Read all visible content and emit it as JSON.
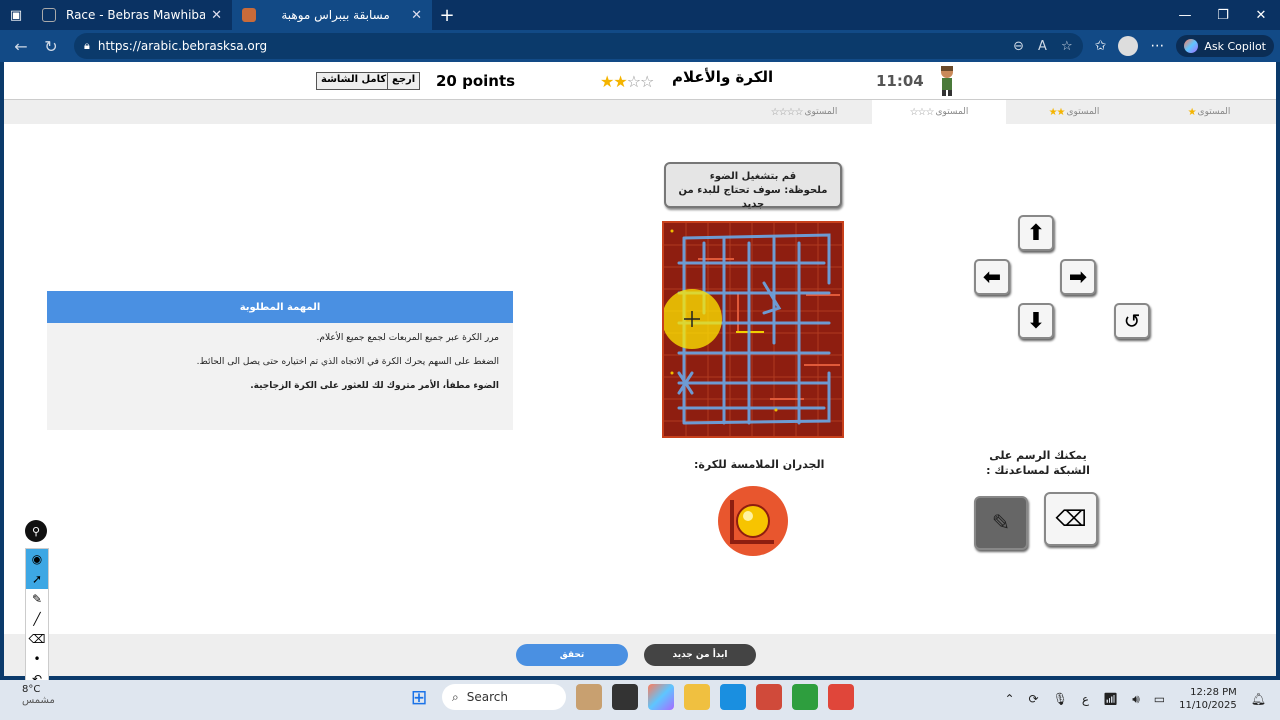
{
  "browser": {
    "tabs": [
      {
        "title": "Race - Bebras Mawhiba",
        "active": false
      },
      {
        "title": "مسابقة بيبراس موهبة",
        "active": true
      }
    ],
    "url": "https://arabic.bebrasksa.org",
    "copilot_label": "Ask Copilot"
  },
  "game": {
    "fullscreen_label": "كامل الشاشة",
    "back_label": "ارجع",
    "points": "20 points",
    "title": "الكرة والأعلام",
    "timer": "11:04"
  },
  "levels": [
    {
      "label": "المستوى",
      "stars": 1
    },
    {
      "label": "المستوى",
      "stars": 2
    },
    {
      "label": "المستوى",
      "stars": 3
    },
    {
      "label": "المستوى",
      "stars": 4
    }
  ],
  "task": {
    "heading": "المهمة المطلوبة",
    "line1": "مرر الكرة عبر جميع المربعات لجمع جميع الأعلام.",
    "line2": "الضغط على السهم يحرك الكرة في الاتجاه الذي تم اختياره حتى يصل الى الحائط.",
    "line3": "الضوء مطفأ، الأمر متروك لك للعثور على الكرة الزجاجية."
  },
  "instruction": {
    "line1": "قم بتشغيل الضوء",
    "line2": "ملحوظة: سوف تحتاج للبدء من جديد"
  },
  "walls_label": "الجدران الملامسة للكرة:",
  "draw_label": "يمكنك الرسم على الشبكة لمساعدتك :",
  "footer": {
    "check_label": "تحقق",
    "restart_label": "ابدأ من جديد"
  },
  "taskbar": {
    "weather": "8°C",
    "weather_sub": "مشمس",
    "search_placeholder": "Search",
    "time": "12:28 PM",
    "date": "11/10/2025",
    "lang": "ع"
  },
  "colors": {
    "grid_bg": "#8e1e10",
    "task_header": "#4a90e2",
    "check_button": "#4a90e2",
    "restart_button": "#444444"
  }
}
